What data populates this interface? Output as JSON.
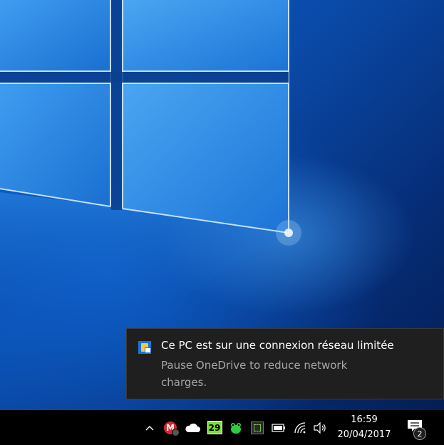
{
  "notification": {
    "title": "Ce PC est sur une connexion réseau limitée",
    "body": "Pause OneDrive to reduce network charges.",
    "app_icon": "network-warning-icon"
  },
  "tray": {
    "overflow_icon": "chevron-up-icon",
    "mega_letter": "M",
    "calendar_day": "29",
    "icons": [
      "mega-icon",
      "onedrive-cloud-icon",
      "calendar-icon",
      "frog-icon",
      "dashed-square-icon",
      "battery-icon",
      "wifi-icon",
      "volume-icon"
    ]
  },
  "clock": {
    "time": "16:59",
    "date": "20/04/2017"
  },
  "action_center": {
    "icon": "notification-icon",
    "count": "2"
  },
  "colors": {
    "taskbar": "#000000",
    "toast_bg": "#1f1f1f",
    "mega_red": "#d9272e",
    "calendar_green": "#7ddc3d"
  }
}
